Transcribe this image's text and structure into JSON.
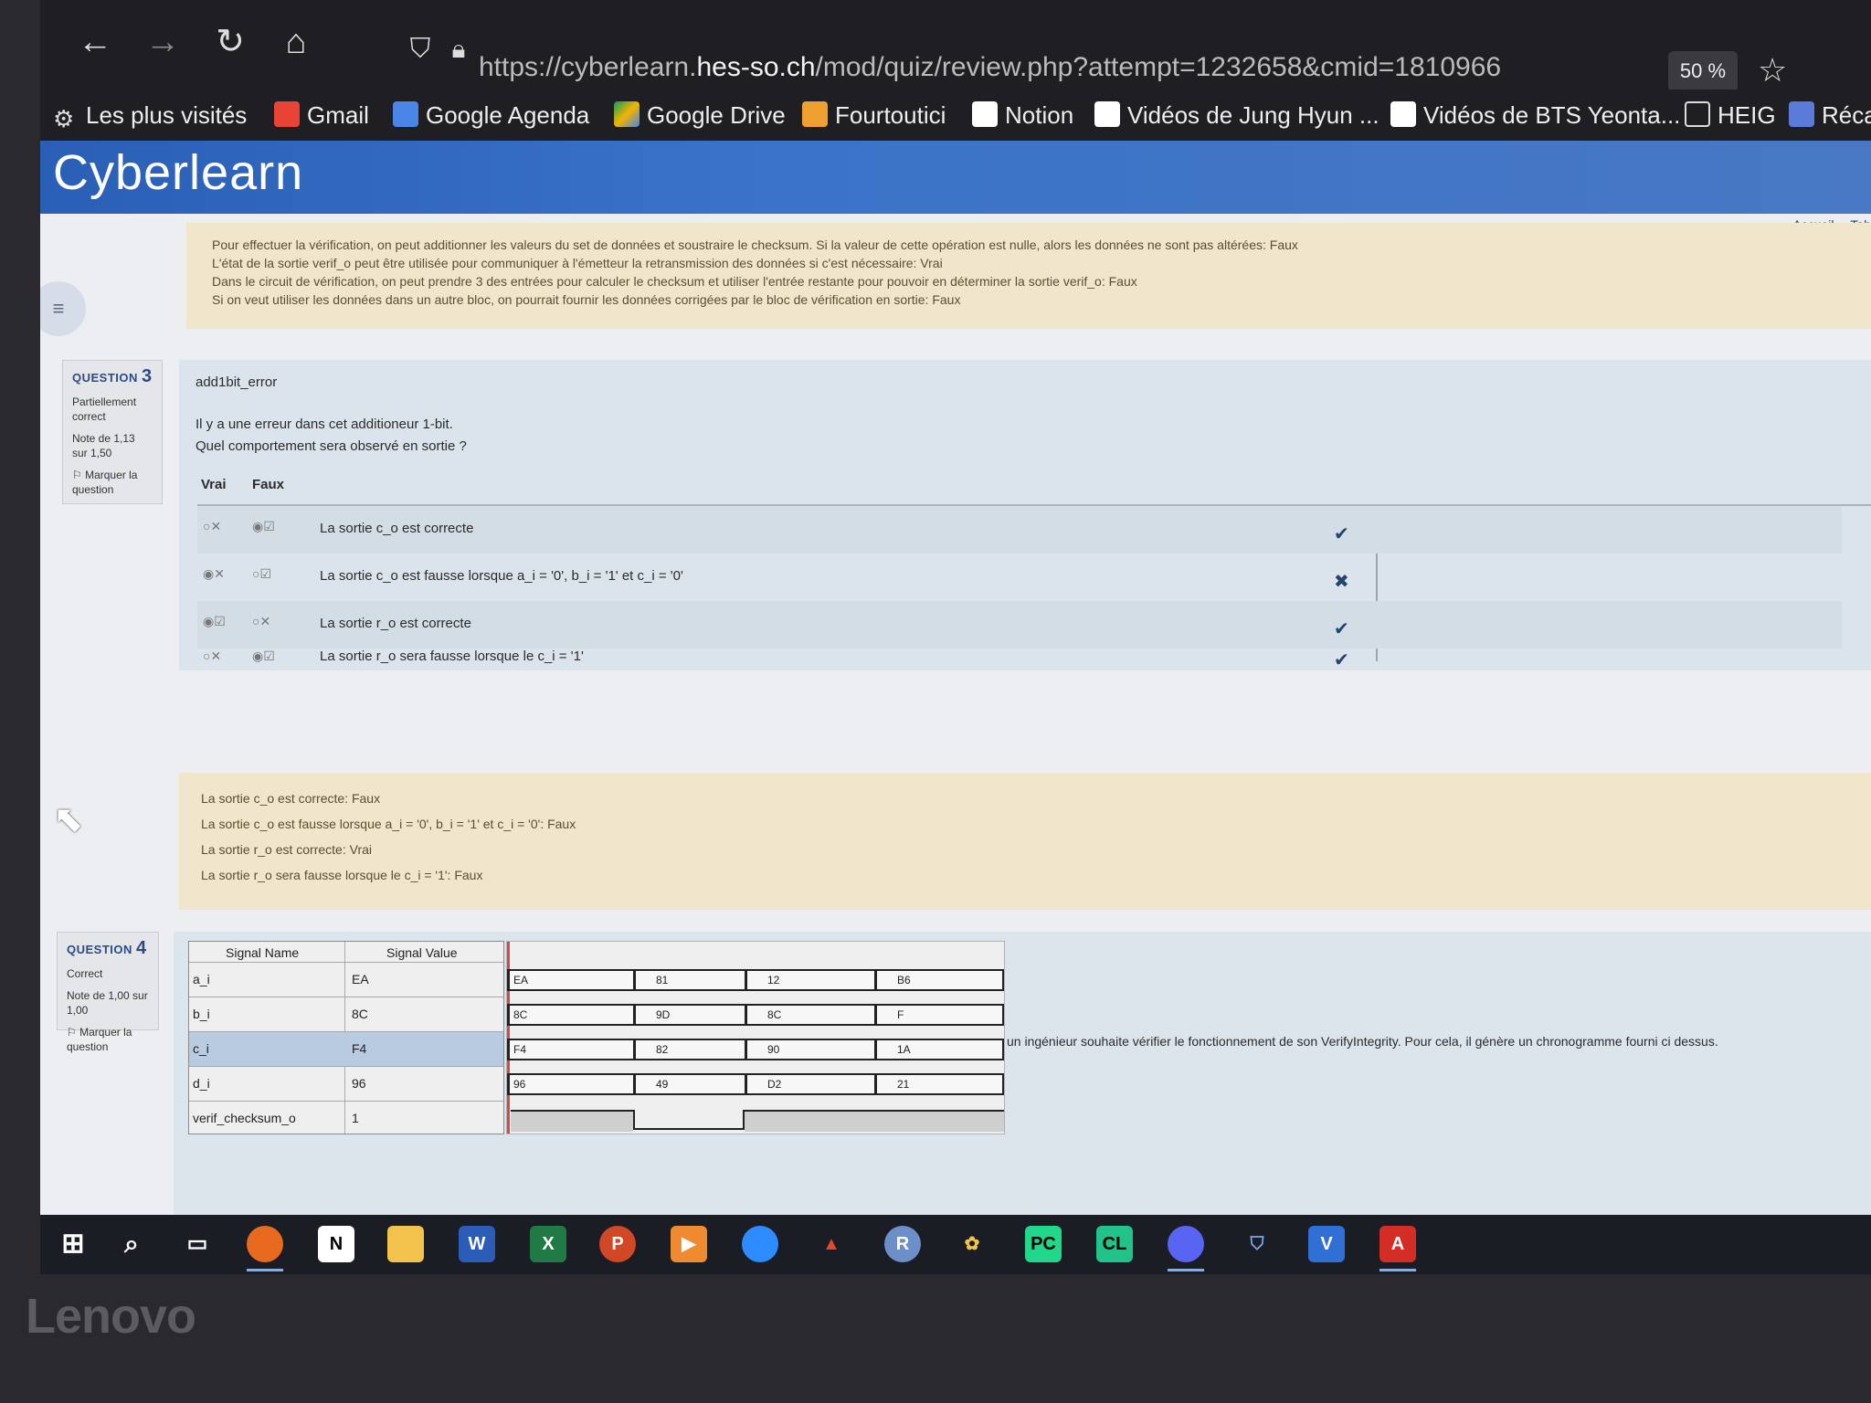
{
  "browser": {
    "url_prefix": "https://cyberlearn.",
    "url_domain": "hes-so.ch",
    "url_path": "/mod/quiz/review.php?attempt=1232658&cmid=1810966",
    "zoom": "50 %",
    "bookmarks": [
      "Les plus visités",
      "Gmail",
      "Google Agenda",
      "Google Drive",
      "Fourtoutici",
      "Notion",
      "Vidéos de Jung Hyun ...",
      "Vidéos de BTS Yeonta...",
      "HEIG",
      "Réca"
    ]
  },
  "site": {
    "logo": "Cyberlearn",
    "nav": [
      "Accueil",
      "Tab"
    ]
  },
  "q2_feedback": [
    "Pour effectuer la vérification, on peut additionner les valeurs du set de données et soustraire le checksum. Si la valeur de cette opération est nulle, alors les données ne sont pas altérées: Faux",
    "L'état de la sortie verif_o peut être utilisée pour communiquer à l'émetteur la retransmission des données si c'est nécessaire: Vrai",
    "Dans le circuit de vérification, on peut prendre 3 des entrées pour calculer le checksum et utiliser l'entrée restante pour pouvoir en déterminer la sortie verif_o: Faux",
    "Si on veut utiliser les données dans un autre bloc, on pourrait fournir les données corrigées par le bloc de vérification en sortie: Faux"
  ],
  "q3": {
    "label": "QUESTION",
    "number": "3",
    "status": "Partiellement correct",
    "grade": "Note de 1,13 sur 1,50",
    "flag": "Marquer la question",
    "title": "add1bit_error",
    "text1": "Il y a une erreur dans cet additioneur 1-bit.",
    "text2": "Quel comportement sera observé en sortie ?",
    "col_true": "Vrai",
    "col_false": "Faux",
    "options": [
      {
        "text": "La sortie c_o est correcte",
        "vrai": "○✕",
        "faux": "◉☑",
        "mark": "✔"
      },
      {
        "text": "La sortie c_o est fausse lorsque a_i = '0', b_i = '1' et c_i = '0'",
        "vrai": "◉✕",
        "faux": "○☑",
        "mark": "✖"
      },
      {
        "text": "La sortie r_o est correcte",
        "vrai": "◉☑",
        "faux": "○✕",
        "mark": "✔"
      },
      {
        "text": "La sortie r_o sera fausse lorsque le c_i = '1'",
        "vrai": "○✕",
        "faux": "◉☑",
        "mark": "✔"
      }
    ],
    "feedback": [
      "La sortie c_o est correcte: Faux",
      "La sortie c_o est fausse lorsque a_i = '0', b_i = '1' et c_i = '0': Faux",
      "La sortie r_o est correcte: Vrai",
      "La sortie r_o sera fausse lorsque le c_i = '1': Faux"
    ]
  },
  "q4": {
    "label": "QUESTION",
    "number": "4",
    "status": "Correct",
    "grade": "Note de 1,00 sur 1,00",
    "flag": "Marquer la question",
    "sig_header_name": "Signal Name",
    "sig_header_value": "Signal Value",
    "signals": [
      {
        "name": "a_i",
        "value": "EA",
        "waves": [
          "EA",
          "81",
          "12",
          "B6"
        ]
      },
      {
        "name": "b_i",
        "value": "8C",
        "waves": [
          "8C",
          "9D",
          "8C",
          "F"
        ]
      },
      {
        "name": "c_i",
        "value": "F4",
        "waves": [
          "F4",
          "82",
          "90",
          "1A"
        ]
      },
      {
        "name": "d_i",
        "value": "96",
        "waves": [
          "96",
          "49",
          "D2",
          "21"
        ]
      },
      {
        "name": "verif_checksum_o",
        "value": "1",
        "waves": []
      }
    ],
    "text": "un ingénieur souhaite vérifier le fonctionnement de son VerifyIntegrity. Pour cela, il génère un chronogramme fourni ci dessus."
  },
  "bezel": "Lenovo"
}
